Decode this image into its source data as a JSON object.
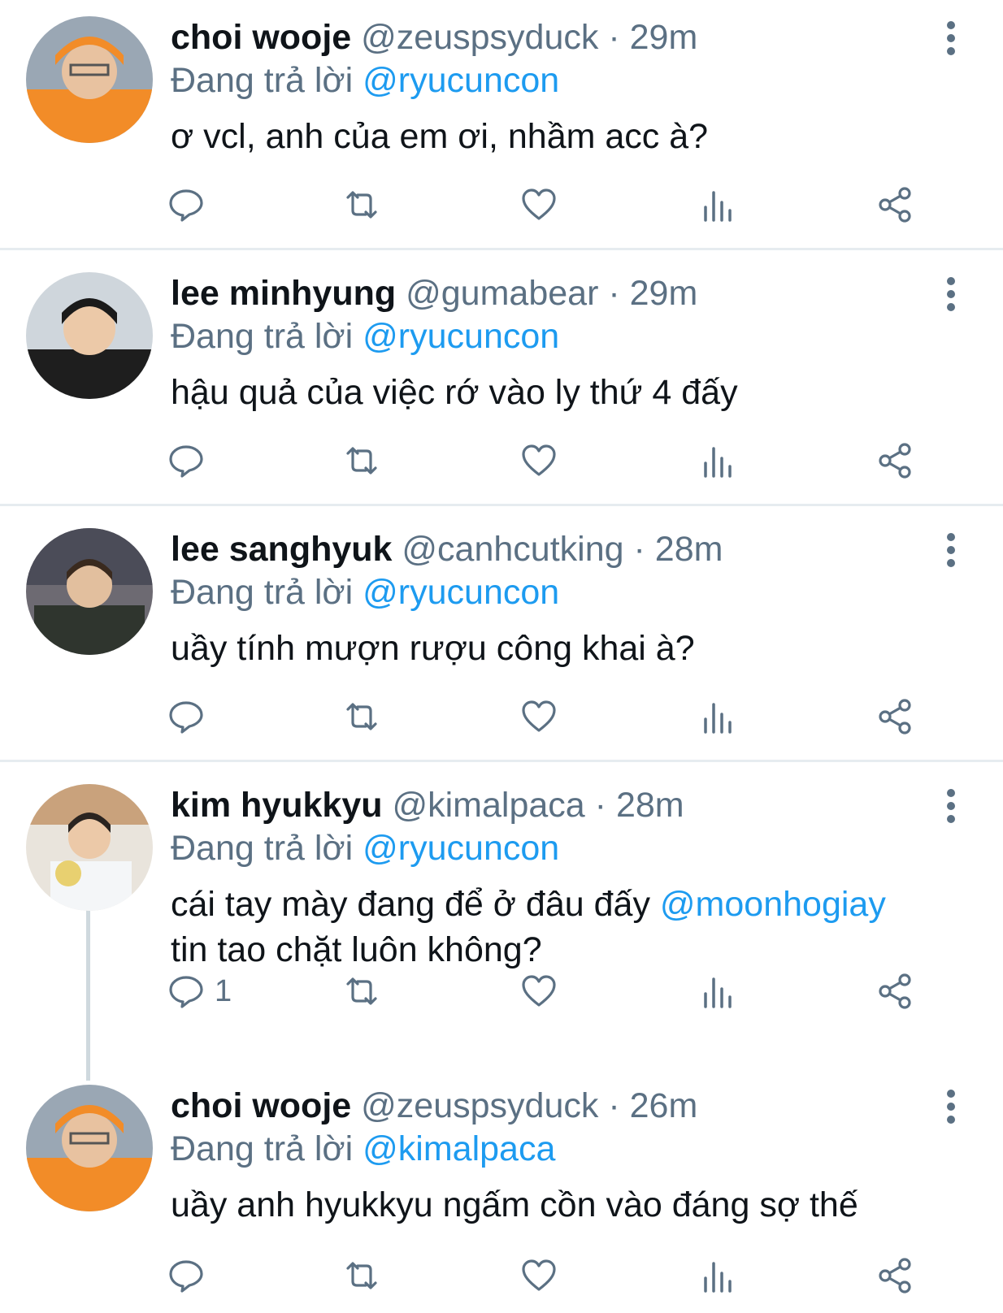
{
  "tweets": [
    {
      "name": "choi wooje",
      "handle": "@zeuspsyduck",
      "time": "29m",
      "reply_prefix": "Đang trả lời",
      "reply_to": "@ryucuncon",
      "text_before": "ơ vcl, anh của em ơi, nhầm acc à?",
      "mention": "",
      "text_after": "",
      "reply_count": "",
      "avatar_color": "#f28c28"
    },
    {
      "name": "lee minhyung",
      "handle": "@gumabear",
      "time": "29m",
      "reply_prefix": "Đang trả lời",
      "reply_to": "@ryucuncon",
      "text_before": "hậu quả của việc rớ vào ly thứ 4 đấy",
      "mention": "",
      "text_after": "",
      "reply_count": "",
      "avatar_color": "#2b2b2b"
    },
    {
      "name": "lee sanghyuk",
      "handle": "@canhcutking",
      "time": "28m",
      "reply_prefix": "Đang trả lời",
      "reply_to": "@ryucuncon",
      "text_before": "uầy tính mượn rượu công khai à?",
      "mention": "",
      "text_after": "",
      "reply_count": "",
      "avatar_color": "#3a3f3a"
    },
    {
      "name": "kim hyukkyu",
      "handle": "@kimalpaca",
      "time": "28m",
      "reply_prefix": "Đang trả lời",
      "reply_to": "@ryucuncon",
      "text_before": "cái tay mày đang để ở đâu đấy ",
      "mention": "@moonhogiay",
      "text_after": "tin tao chặt luôn không?",
      "reply_count": "1",
      "avatar_color": "#e9e4dc"
    },
    {
      "name": "choi wooje",
      "handle": "@zeuspsyduck",
      "time": "26m",
      "reply_prefix": "Đang trả lời",
      "reply_to": "@kimalpaca",
      "text_before": "uầy anh hyukkyu ngấm cồn vào đáng sợ thế",
      "mention": "",
      "text_after": "",
      "reply_count": "",
      "avatar_color": "#f28c28"
    }
  ],
  "colors": {
    "link": "#1d9bf0",
    "muted": "#5b7083",
    "divider": "#e6ecf0"
  },
  "icons": [
    "reply-icon",
    "retweet-icon",
    "like-icon",
    "views-icon",
    "share-icon",
    "more-icon"
  ]
}
